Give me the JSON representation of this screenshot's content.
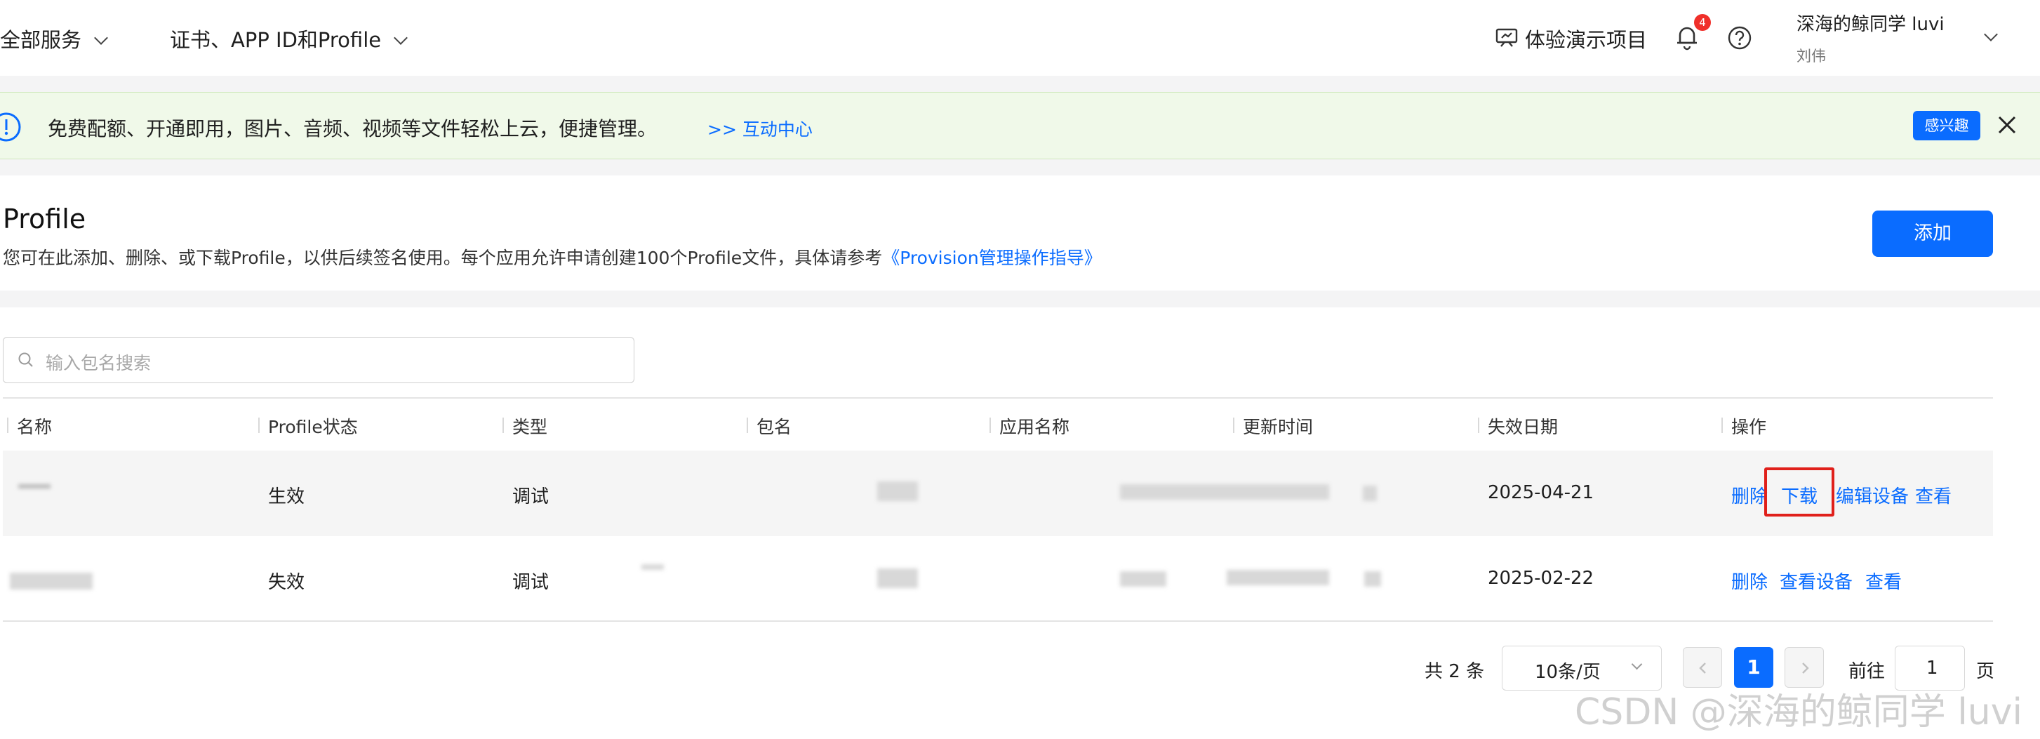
{
  "header": {
    "all_services": "全部服务",
    "cert_menu": "证书、APP ID和Profile",
    "demo": "体验演示项目",
    "notification_count": "4",
    "user_name": "深海的鲸同学 luvi",
    "user_sub": "刘伟"
  },
  "notice": {
    "text": "免费配额、开通即用，图片、音频、视频等文件轻松上云，便捷管理。",
    "link": ">> 互动中心",
    "interest_button": "感兴趣"
  },
  "page": {
    "title": "Profile",
    "description": "您可在此添加、删除、或下载Profile，以供后续签名使用。每个应用允许申请创建100个Profile文件，具体请参考",
    "guide_link": "《Provision管理操作指导》",
    "add_button": "添加"
  },
  "search": {
    "placeholder": "输入包名搜索"
  },
  "table": {
    "columns": [
      "名称",
      "Profile状态",
      "类型",
      "包名",
      "应用名称",
      "更新时间",
      "失效日期",
      "操作"
    ],
    "rows": [
      {
        "status": "生效",
        "type": "调试",
        "expiry": "2025-04-21",
        "actions": [
          "删除",
          "下载",
          "编辑设备",
          "查看"
        ]
      },
      {
        "status": "失效",
        "type": "调试",
        "expiry": "2025-02-22",
        "actions": [
          "删除",
          "查看设备",
          "查看"
        ]
      }
    ]
  },
  "pagination": {
    "total": "共 2 条",
    "page_size": "10条/页",
    "current_page": "1",
    "goto_label": "前往",
    "goto_value": "1",
    "page_suffix": "页"
  },
  "watermark": "CSDN @深海的鲸同学 luvi",
  "colors": {
    "accent": "#0a6cff",
    "highlight_box": "#e0201b",
    "notice_bg": "#f0f9e9"
  }
}
